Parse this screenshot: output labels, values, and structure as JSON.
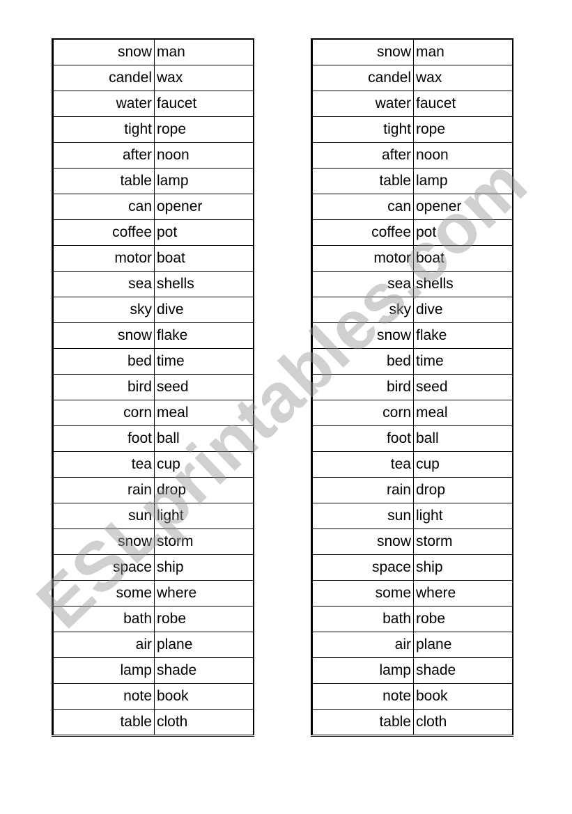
{
  "watermark": "ESLprintables.com",
  "pairs": [
    [
      "snow",
      "man"
    ],
    [
      "candel",
      "wax"
    ],
    [
      "water",
      "faucet"
    ],
    [
      "tight",
      "rope"
    ],
    [
      "after",
      "noon"
    ],
    [
      "table",
      "lamp"
    ],
    [
      "can",
      "opener"
    ],
    [
      "coffee",
      "pot"
    ],
    [
      "motor",
      "boat"
    ],
    [
      "sea",
      "shells"
    ],
    [
      "sky",
      "dive"
    ],
    [
      "snow",
      "flake"
    ],
    [
      "bed",
      "time"
    ],
    [
      "bird",
      "seed"
    ],
    [
      "corn",
      "meal"
    ],
    [
      "foot",
      "ball"
    ],
    [
      "tea",
      "cup"
    ],
    [
      "rain",
      "drop"
    ],
    [
      "sun",
      "light"
    ],
    [
      "snow",
      "storm"
    ],
    [
      "space",
      "ship"
    ],
    [
      "some",
      "where"
    ],
    [
      "bath",
      "robe"
    ],
    [
      "air",
      "plane"
    ],
    [
      "lamp",
      "shade"
    ],
    [
      "note",
      "book"
    ],
    [
      "table",
      "cloth"
    ]
  ]
}
